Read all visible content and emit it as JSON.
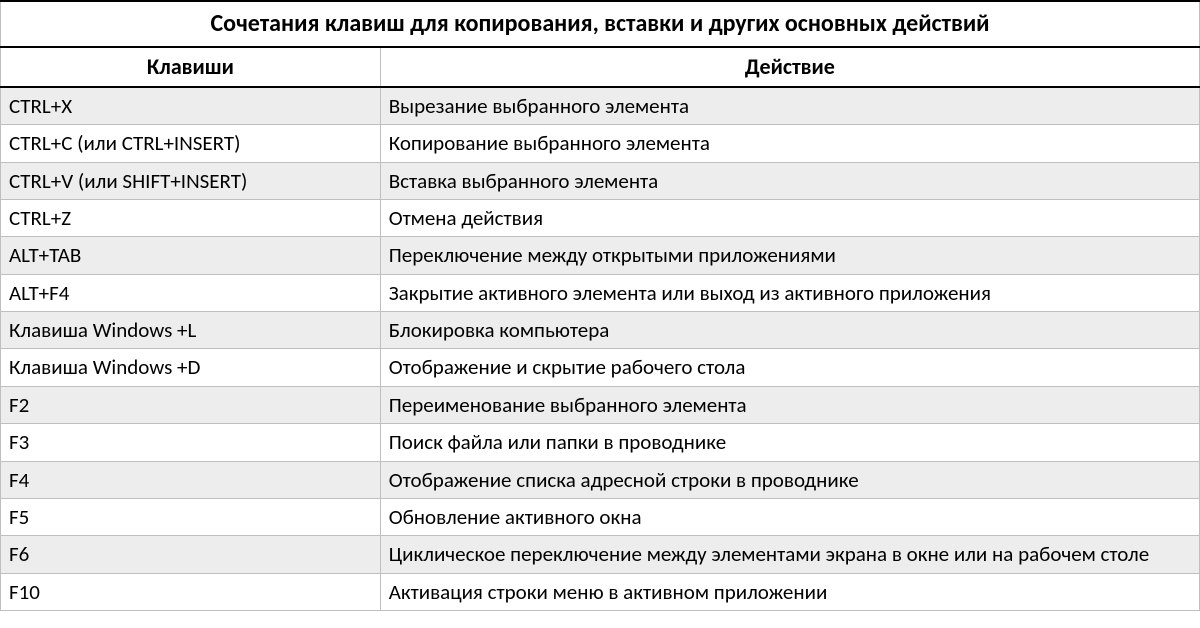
{
  "table": {
    "title": "Сочетания клавиш для копирования, вставки и других основных действий",
    "headers": {
      "keys": "Клавиши",
      "action": "Действие"
    },
    "rows": [
      {
        "keys": "CTRL+X",
        "action": "Вырезание выбранного элемента"
      },
      {
        "keys": "CTRL+C (или CTRL+INSERT)",
        "action": "Копирование выбранного элемента"
      },
      {
        "keys": "CTRL+V (или SHIFT+INSERT)",
        "action": "Вставка выбранного элемента"
      },
      {
        "keys": "CTRL+Z",
        "action": "Отмена действия"
      },
      {
        "keys": "ALT+TAB",
        "action": "Переключение между открытыми приложениями"
      },
      {
        "keys": "ALT+F4",
        "action": "Закрытие активного элемента или выход из активного приложения"
      },
      {
        "keys": "Клавиша Windows  +L",
        "action": "Блокировка компьютера"
      },
      {
        "keys": "Клавиша Windows  +D",
        "action": "Отображение и скрытие рабочего стола"
      },
      {
        "keys": "F2",
        "action": "Переименование выбранного элемента"
      },
      {
        "keys": "F3",
        "action": "Поиск файла или папки в проводнике"
      },
      {
        "keys": "F4",
        "action": "Отображение списка адресной строки в проводнике"
      },
      {
        "keys": "F5",
        "action": "Обновление активного окна"
      },
      {
        "keys": "F6",
        "action": "Циклическое переключение между элементами экрана в окне или на рабочем столе"
      },
      {
        "keys": "F10",
        "action": "Активация строки меню в активном приложении"
      }
    ]
  }
}
